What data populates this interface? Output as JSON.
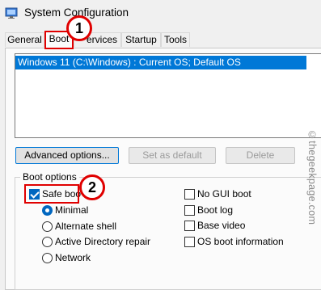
{
  "window": {
    "title": "System Configuration",
    "icon": "system-config-icon"
  },
  "tabs": [
    {
      "label": "General",
      "active": false
    },
    {
      "label": "Boot",
      "active": true
    },
    {
      "label": "Services",
      "active": false
    },
    {
      "label": "Startup",
      "active": false
    },
    {
      "label": "Tools",
      "active": false
    }
  ],
  "tabs_visible_text": {
    "services": "ervices"
  },
  "os_list": {
    "items": [
      "Windows 11 (C:\\Windows) : Current OS; Default OS"
    ],
    "selected_index": 0
  },
  "buttons": {
    "advanced": {
      "label": "Advanced options...",
      "enabled": true
    },
    "set_default": {
      "label": "Set as default",
      "enabled": false
    },
    "delete": {
      "label": "Delete",
      "enabled": false
    }
  },
  "boot_options": {
    "group_label": "Boot options",
    "safe_boot": {
      "label": "Safe boot",
      "visible_text": "Safe boo",
      "checked": true
    },
    "radios": [
      {
        "label": "Minimal",
        "checked": true
      },
      {
        "label": "Alternate shell",
        "checked": false
      },
      {
        "label": "Active Directory repair",
        "checked": false
      },
      {
        "label": "Network",
        "checked": false
      }
    ],
    "right_checks": [
      {
        "label": "No GUI boot",
        "checked": false
      },
      {
        "label": "Boot log",
        "checked": false
      },
      {
        "label": "Base video",
        "checked": false
      },
      {
        "label": "OS boot information",
        "checked": false
      }
    ]
  },
  "callouts": [
    {
      "number": "1"
    },
    {
      "number": "2"
    }
  ],
  "watermark": "©thegeekpage.com",
  "colors": {
    "selection": "#0078d7",
    "callout_red": "#e00000",
    "checkbox_blue": "#0067c0"
  }
}
